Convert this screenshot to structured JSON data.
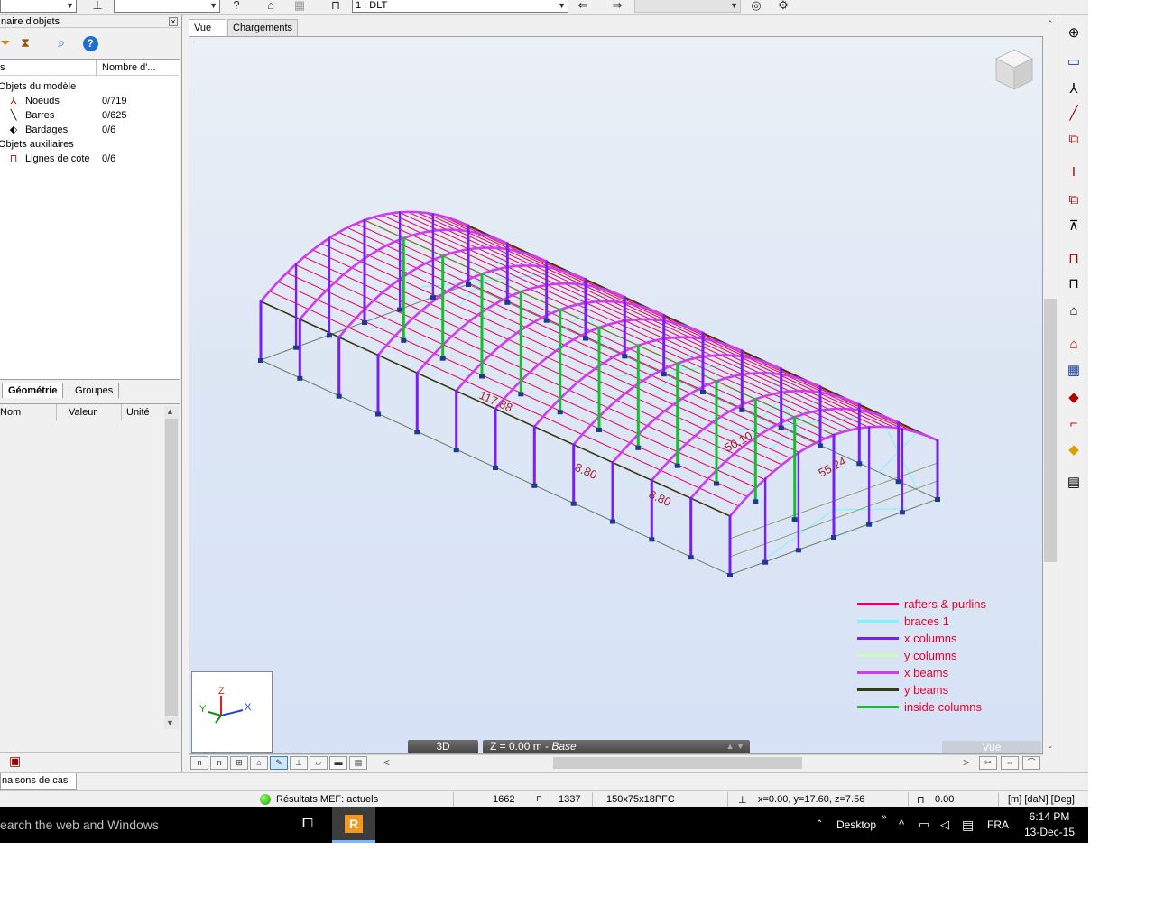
{
  "toolbar": {
    "case_select": "1 : DLT",
    "blank_select": ""
  },
  "object_inspector": {
    "title": "naire d'objets",
    "columns": {
      "name": "s",
      "count": "Nombre d'..."
    },
    "tree": [
      {
        "label": "Objets du modèle",
        "value": ""
      },
      {
        "label": "Noeuds",
        "value": "0/719"
      },
      {
        "label": "Barres",
        "value": "0/625"
      },
      {
        "label": "Bardages",
        "value": "0/6"
      },
      {
        "label": "Objets auxiliaires",
        "value": ""
      },
      {
        "label": "Lignes de cote",
        "value": "0/6"
      }
    ],
    "tabs": {
      "geometry": "Géométrie",
      "groups": "Groupes"
    },
    "properties_columns": {
      "name": "Nom",
      "value": "Valeur",
      "unit": "Unité"
    }
  },
  "view": {
    "tabs": {
      "vue": "Vue",
      "loads": "Chargements"
    },
    "mode_3d": "3D",
    "plane": "Z = 0.00 m - ",
    "plane_name": "Base",
    "vue_badge": "Vue",
    "dims": [
      "117.88",
      "8.80",
      "8.80",
      "50.10",
      "55.24"
    ],
    "axes": {
      "x": "X",
      "y": "Y",
      "z": "Z"
    }
  },
  "legend": [
    {
      "label": "rafters & purlins",
      "color": "#e8005a"
    },
    {
      "label": "braces 1",
      "color": "#7ff2ff"
    },
    {
      "label": "x columns",
      "color": "#7a1ff0"
    },
    {
      "label": "y columns",
      "color": "#c8ffb0"
    },
    {
      "label": "x beams",
      "color": "#cc3cf0"
    },
    {
      "label": "y beams",
      "color": "#3a3a10"
    },
    {
      "label": "inside columns",
      "color": "#14c030"
    }
  ],
  "bottom": {
    "combo_tab": "naisons de cas"
  },
  "statusbar": {
    "fem_results": "Résultats MEF: actuels",
    "node_count": "1662",
    "bar_count": "1337",
    "section": "150x75x18PFC",
    "coords": "x=0.00, y=17.60, z=7.56",
    "angle": "0.00",
    "units": "[m] [daN] [Deg]"
  },
  "taskbar": {
    "search": "earch the web and Windows",
    "desktop": "Desktop",
    "lang": "FRA",
    "time": "6:14 PM",
    "date": "13-Dec-15"
  }
}
